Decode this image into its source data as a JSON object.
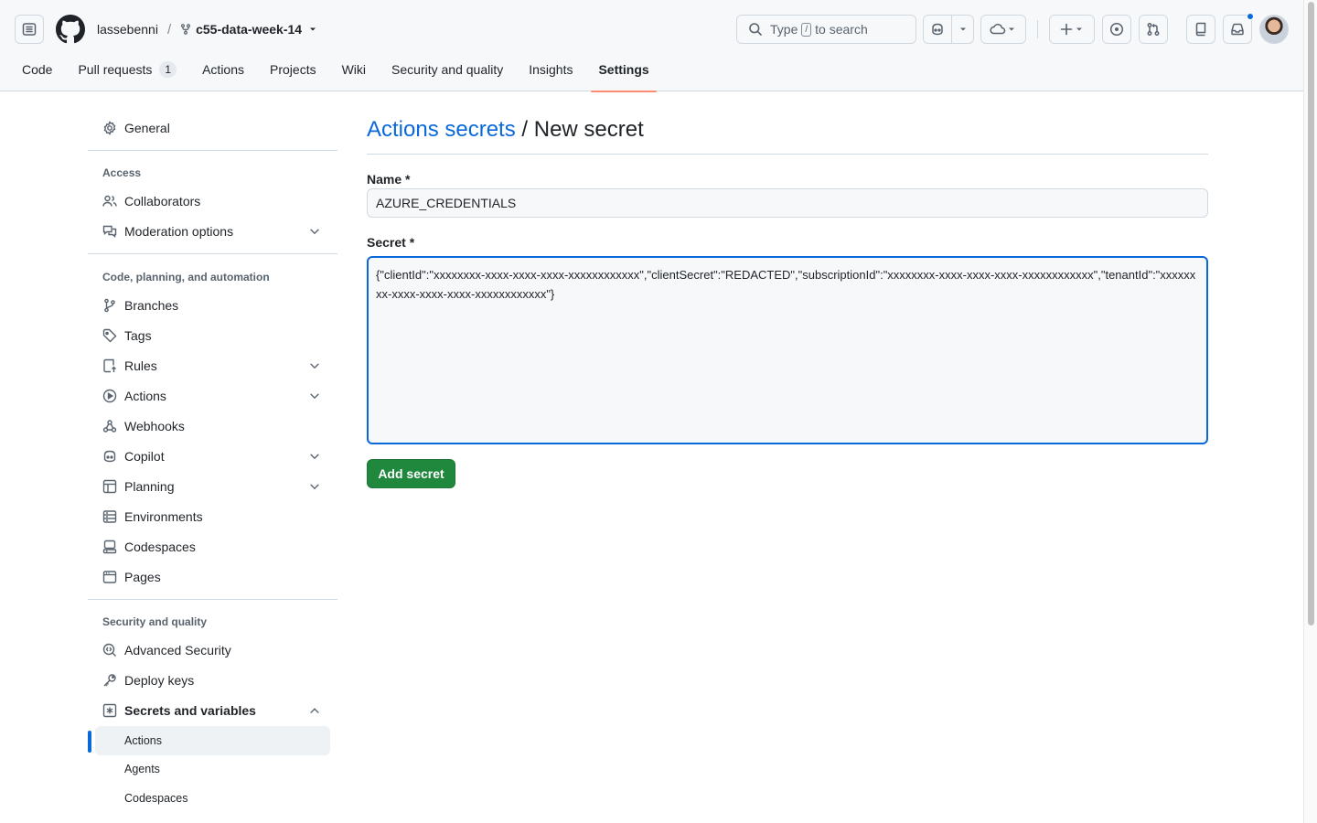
{
  "header": {
    "owner": "lassebenni",
    "separator": "/",
    "repo": "c55-data-week-14",
    "search": {
      "pre": "Type",
      "key": "/",
      "post": "to search"
    }
  },
  "tabs": [
    {
      "label": "Code"
    },
    {
      "label": "Pull requests",
      "count": "1"
    },
    {
      "label": "Actions"
    },
    {
      "label": "Projects"
    },
    {
      "label": "Wiki"
    },
    {
      "label": "Security and quality"
    },
    {
      "label": "Insights"
    },
    {
      "label": "Settings"
    }
  ],
  "sidebar": {
    "general": "General",
    "access_heading": "Access",
    "collaborators": "Collaborators",
    "moderation": "Moderation options",
    "code_heading": "Code, planning, and automation",
    "branches": "Branches",
    "tags": "Tags",
    "rules": "Rules",
    "actions": "Actions",
    "webhooks": "Webhooks",
    "copilot": "Copilot",
    "planning": "Planning",
    "environments": "Environments",
    "codespaces": "Codespaces",
    "pages": "Pages",
    "security_heading": "Security and quality",
    "advanced_security": "Advanced Security",
    "deploy_keys": "Deploy keys",
    "secrets_variables": "Secrets and variables",
    "sub_actions": "Actions",
    "sub_agents": "Agents",
    "sub_codespaces": "Codespaces"
  },
  "main": {
    "breadcrumb": "Actions secrets",
    "title_rest": " / New secret",
    "name_label": "Name *",
    "name_value": "AZURE_CREDENTIALS",
    "secret_label": "Secret *",
    "secret_value": "{\"clientId\":\"xxxxxxxx-xxxx-xxxx-xxxx-xxxxxxxxxxxx\",\"clientSecret\":\"REDACTED\",\"subscriptionId\":\"xxxxxxxx-xxxx-xxxx-xxxx-xxxxxxxxxxxx\",\"tenantId\":\"xxxxxxxx-xxxx-xxxx-xxxx-xxxxxxxxxxxx\"}",
    "add_button": "Add secret"
  },
  "colors": {
    "accent": "#0969da",
    "primary_button": "#1f883d",
    "selected_tab_underline": "#fd8c73"
  }
}
